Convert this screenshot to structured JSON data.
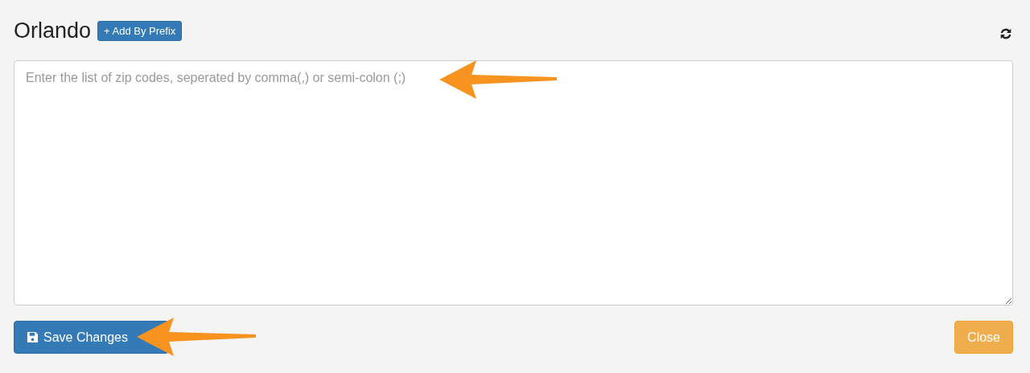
{
  "header": {
    "title": "Orlando",
    "add_button": "+ Add By Prefix"
  },
  "zip_field": {
    "placeholder": "Enter the list of zip codes, seperated by comma(,) or semi-colon (;)"
  },
  "footer": {
    "save_button": "Save Changes",
    "close_button": "Close"
  }
}
